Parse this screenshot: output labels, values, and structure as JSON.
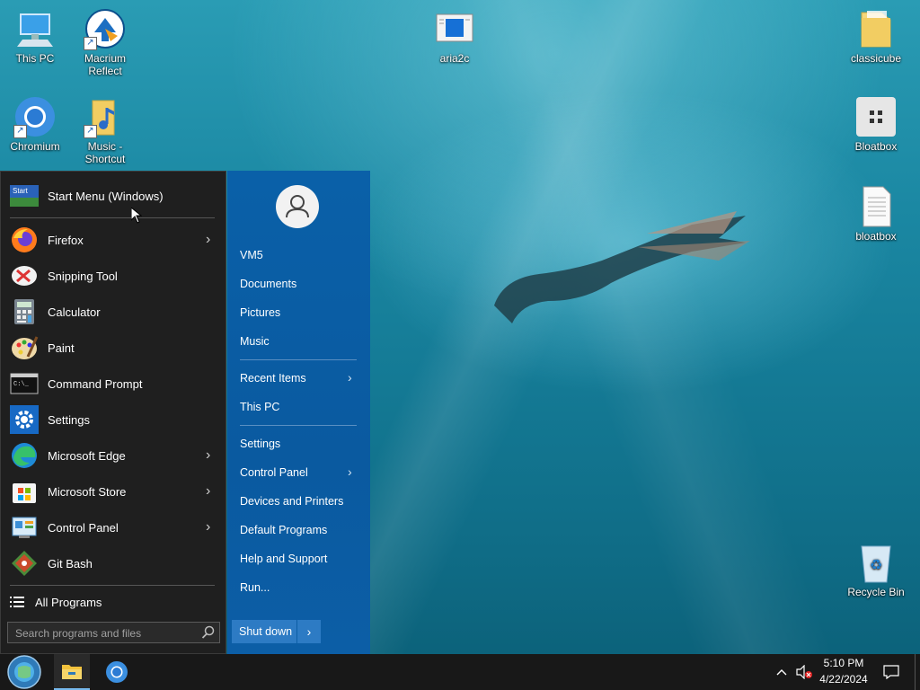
{
  "desktop_icons": [
    {
      "name": "this-pc",
      "label": "This PC"
    },
    {
      "name": "macrium-reflect",
      "label": "Macrium Reflect"
    },
    {
      "name": "aria2c",
      "label": "aria2c"
    },
    {
      "name": "classicube",
      "label": "classicube"
    },
    {
      "name": "chromium",
      "label": "Chromium"
    },
    {
      "name": "music-shortcut",
      "label": "Music - Shortcut"
    },
    {
      "name": "bloatbox-app",
      "label": "Bloatbox"
    },
    {
      "name": "bloatbox-file",
      "label": "bloatbox"
    },
    {
      "name": "recycle-bin",
      "label": "Recycle Bin"
    }
  ],
  "start_menu": {
    "header": {
      "label": "Start Menu (Windows)",
      "icon": "start-menu-logo-icon"
    },
    "programs": [
      {
        "label": "Firefox",
        "icon": "firefox-icon",
        "has_submenu": true
      },
      {
        "label": "Snipping Tool",
        "icon": "snipping-tool-icon",
        "has_submenu": false
      },
      {
        "label": "Calculator",
        "icon": "calculator-icon",
        "has_submenu": false
      },
      {
        "label": "Paint",
        "icon": "paint-icon",
        "has_submenu": false
      },
      {
        "label": "Command Prompt",
        "icon": "command-prompt-icon",
        "has_submenu": false
      },
      {
        "label": "Settings",
        "icon": "settings-gear-icon",
        "has_submenu": false
      },
      {
        "label": "Microsoft Edge",
        "icon": "edge-icon",
        "has_submenu": true
      },
      {
        "label": "Microsoft Store",
        "icon": "store-icon",
        "has_submenu": true
      },
      {
        "label": "Control Panel",
        "icon": "control-panel-icon",
        "has_submenu": true
      },
      {
        "label": "Git Bash",
        "icon": "git-bash-icon",
        "has_submenu": false
      }
    ],
    "all_programs": "All Programs",
    "search": {
      "placeholder": "Search programs and files",
      "value": ""
    },
    "right_pane": {
      "user": "VM5",
      "items": [
        {
          "label": "Documents"
        },
        {
          "label": "Pictures"
        },
        {
          "label": "Music"
        },
        {
          "label": "Recent Items",
          "has_submenu": true
        },
        {
          "label": "This PC"
        },
        {
          "label": "Settings"
        },
        {
          "label": "Control Panel",
          "has_submenu": true
        },
        {
          "label": "Devices and Printers"
        },
        {
          "label": "Default Programs"
        },
        {
          "label": "Help and Support"
        },
        {
          "label": "Run..."
        }
      ],
      "shutdown_label": "Shut down"
    }
  },
  "taskbar": {
    "pinned": [
      "start-orb",
      "file-explorer",
      "chromium"
    ],
    "clock_time": "5:10 PM",
    "clock_date": "4/22/2024"
  },
  "colors": {
    "menu_left_bg": "#1f1f1f",
    "menu_right_bg": "#0a5aa0",
    "taskbar_bg": "#181818",
    "accent": "#2d7bc4"
  }
}
